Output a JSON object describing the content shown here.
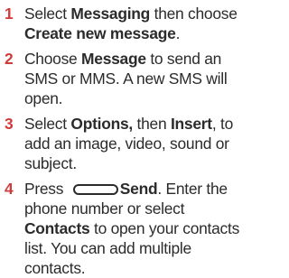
{
  "steps": [
    {
      "number": "1",
      "text_1": "Select ",
      "bold_1": "Messaging",
      "text_2": " then choose ",
      "bold_2": "Create new message",
      "text_3": "."
    },
    {
      "number": "2",
      "text_1": "Choose ",
      "bold_1": "Message",
      "text_2": " to send an SMS or MMS. A new SMS will open."
    },
    {
      "number": "3",
      "text_1": "Select ",
      "bold_1": "Options,",
      "text_2": " then ",
      "bold_2": "Insert",
      "text_3": ", to add an image, video, sound or subject."
    },
    {
      "number": "4",
      "text_1": "Press ",
      "key_icon": "softkey-button-icon",
      "bold_1": "Send",
      "text_2": ". Enter the phone number or select ",
      "bold_2": "Contacts",
      "text_3": " to open your contacts list. You can add multiple contacts."
    }
  ],
  "colors": {
    "number": "#cf3a3a",
    "text": "#2b2b2b"
  }
}
